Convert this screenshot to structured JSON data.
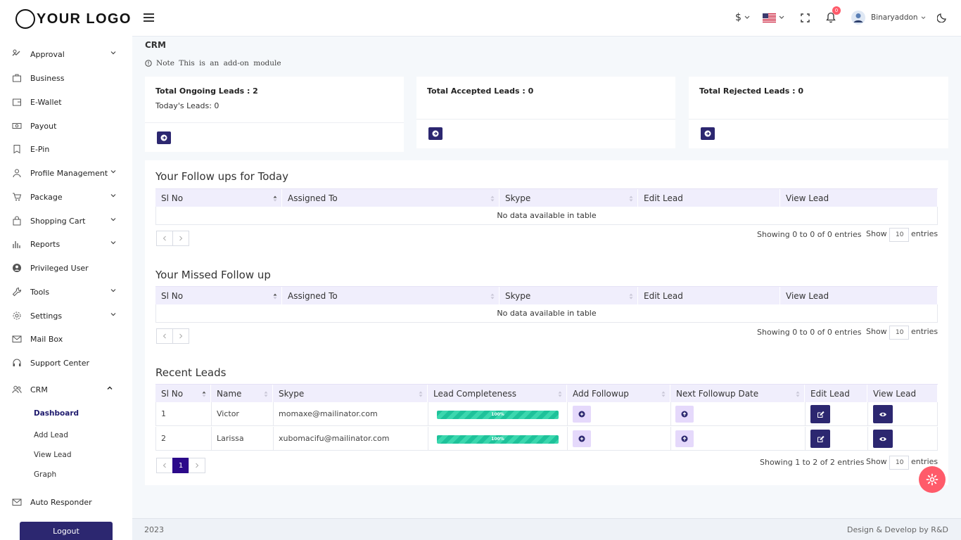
{
  "logo": {
    "text": "YOUR LOGO"
  },
  "sidebar": {
    "items": [
      {
        "label": "Approval",
        "icon": "approval-icon",
        "chevron": "down"
      },
      {
        "label": "Business",
        "icon": "briefcase-icon",
        "chevron": ""
      },
      {
        "label": "E-Wallet",
        "icon": "wallet-icon",
        "chevron": ""
      },
      {
        "label": "Payout",
        "icon": "money-icon",
        "chevron": ""
      },
      {
        "label": "E-Pin",
        "icon": "bookmark-icon",
        "chevron": ""
      },
      {
        "label": "Profile Management",
        "icon": "user-icon",
        "chevron": "down"
      },
      {
        "label": "Package",
        "icon": "cart-icon",
        "chevron": "down"
      },
      {
        "label": "Shopping Cart",
        "icon": "bag-icon",
        "chevron": "down"
      },
      {
        "label": "Reports",
        "icon": "bar-chart-icon",
        "chevron": "down"
      },
      {
        "label": "Privileged User",
        "icon": "user-circle-icon",
        "chevron": ""
      },
      {
        "label": "Tools",
        "icon": "wrench-icon",
        "chevron": "down"
      },
      {
        "label": "Settings",
        "icon": "gear-icon",
        "chevron": "down"
      },
      {
        "label": "Mail Box",
        "icon": "mail-icon",
        "chevron": ""
      },
      {
        "label": "Support Center",
        "icon": "headset-icon",
        "chevron": ""
      },
      {
        "label": "CRM",
        "icon": "users-icon",
        "chevron": "up"
      },
      {
        "label": "Auto Responder",
        "icon": "mail-icon",
        "chevron": ""
      }
    ],
    "crm_sub": [
      "Dashboard",
      "Add Lead",
      "View Lead",
      "Graph"
    ],
    "logout_label": "Logout"
  },
  "topbar": {
    "currency": "$",
    "notification_count": "0",
    "username": "Binaryaddon"
  },
  "page": {
    "title": "CRM",
    "note": "Note This is an add-on module"
  },
  "cards": {
    "ongoing": "Total Ongoing Leads : 2",
    "today": "Today's Leads: 0",
    "accepted": "Total Accepted Leads : 0",
    "rejected": "Total Rejected Leads : 0"
  },
  "followups": {
    "title": "Your Follow ups for Today",
    "columns": [
      "Sl No",
      "Assigned To",
      "Skype",
      "Edit Lead",
      "View Lead"
    ],
    "empty": "No data available in table",
    "info": "Showing 0 to 0 of 0 entries",
    "show": "Show",
    "page_size": "10",
    "entries": "entries"
  },
  "missed": {
    "title": "Your Missed Follow up",
    "columns": [
      "Sl No",
      "Assigned To",
      "Skype",
      "Edit Lead",
      "View Lead"
    ],
    "empty": "No data available in table",
    "info": "Showing 0 to 0 of 0 entries",
    "show": "Show",
    "page_size": "10",
    "entries": "entries"
  },
  "recent": {
    "title": "Recent Leads",
    "columns": [
      "Sl No",
      "Name",
      "Skype",
      "Lead Completeness",
      "Add Followup",
      "Next Followup Date",
      "Edit Lead",
      "View Lead"
    ],
    "rows": [
      {
        "no": "1",
        "name": "Victor",
        "skype": "momaxe@mailinator.com",
        "completeness": "100%"
      },
      {
        "no": "2",
        "name": "Larissa",
        "skype": "xubomacifu@mailinator.com",
        "completeness": "100%"
      }
    ],
    "info": "Showing 1 to 2 of 2 entries",
    "show": "Show",
    "page_size": "10",
    "entries": "entries",
    "current_page": "1"
  },
  "footer": {
    "year": "2023",
    "credit": "Design & Develop by R&D"
  },
  "colors": {
    "accent": "#2c2770",
    "progress": "#1ec29a",
    "alert": "#ff5b6a"
  }
}
